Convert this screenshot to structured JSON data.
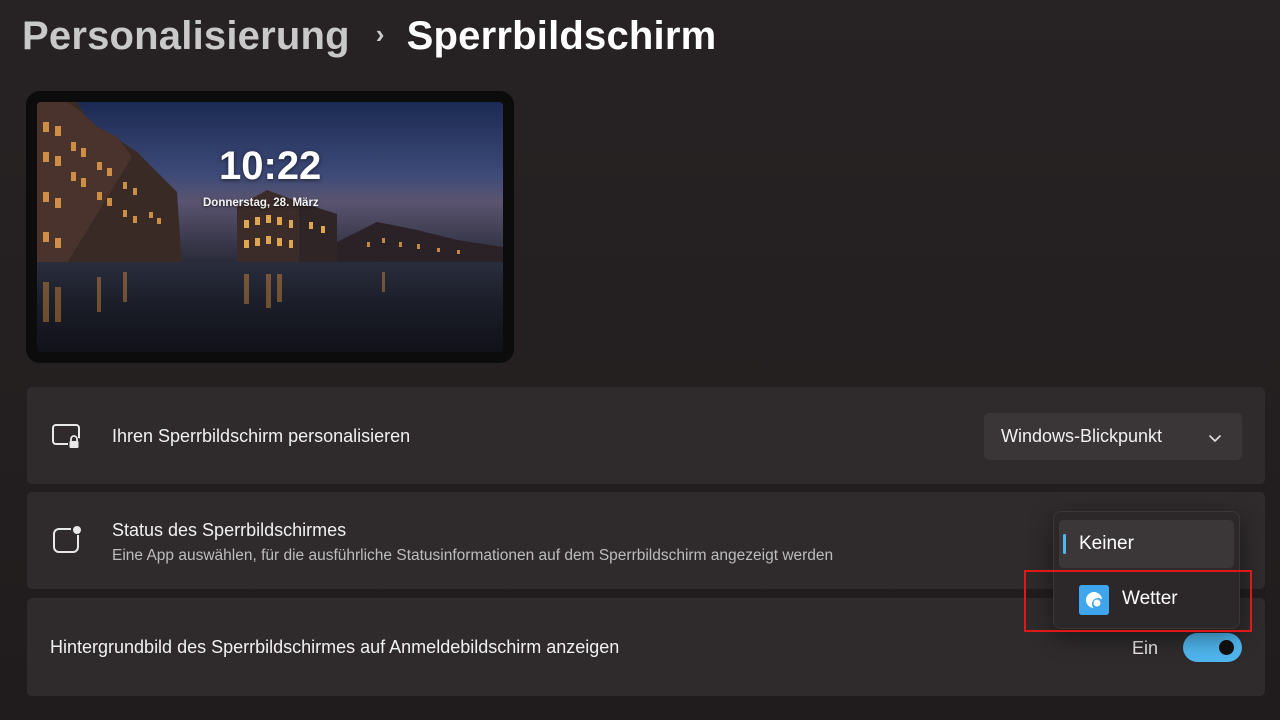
{
  "breadcrumb": {
    "parent": "Personalisierung",
    "separator": "›",
    "current": "Sperrbildschirm"
  },
  "preview": {
    "time": "10:22",
    "date": "Donnerstag, 28. März"
  },
  "settings": {
    "personalize": {
      "icon": "monitor-lock-icon",
      "title": "Ihren Sperrbildschirm personalisieren",
      "dropdown_value": "Windows-Blickpunkt"
    },
    "status": {
      "icon": "app-status-icon",
      "title": "Status des Sperrbildschirmes",
      "description": "Eine App auswählen, für die ausführliche Statusinformationen auf dem Sperrbildschirm angezeigt werden"
    },
    "signin_background": {
      "title": "Hintergrundbild des Sperrbildschirmes auf Anmeldebildschirm anzeigen",
      "toggle_label": "Ein",
      "toggle_on": true
    }
  },
  "status_menu": {
    "items": [
      {
        "label": "Keiner",
        "selected": true
      },
      {
        "label": "Wetter",
        "icon": "weather-app-icon",
        "selected": false
      }
    ]
  },
  "colors": {
    "accent": "#4fb6ee",
    "highlight": "#e01818",
    "card_bg": "#2f2b2c"
  }
}
